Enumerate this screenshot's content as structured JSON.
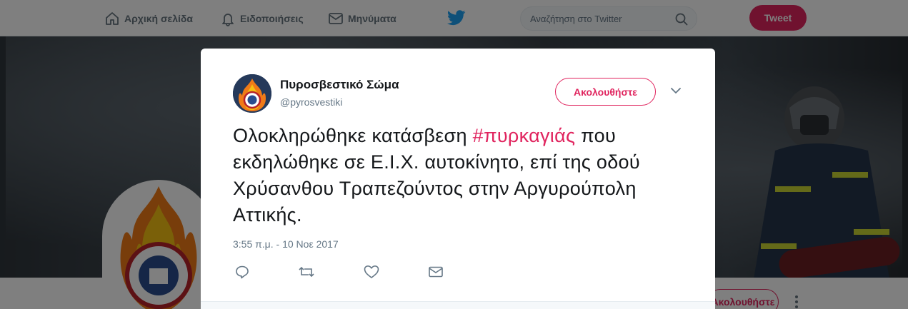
{
  "nav": {
    "home": "Αρχική σελίδα",
    "notifications": "Ειδοποιήσεις",
    "messages": "Μηνύματα",
    "search_placeholder": "Αναζήτηση στο Twitter",
    "tweet_button": "Tweet"
  },
  "profile": {
    "follow_label": "Ακολουθήστε"
  },
  "tweet": {
    "author_name": "Πυροσβεστικό Σώμα",
    "author_handle": "@pyrosvestiki",
    "follow_label": "Ακολουθήστε",
    "text_before": "Ολοκληρώθηκε κατάσβεση ",
    "hashtag": "#πυρκαγιάς",
    "text_after": " που εκδηλώθηκε σε Ε.Ι.Χ. αυτοκίνητο, επί της οδού Χρύσανθου Τραπεζούντος στην Αργυρούπολη Αττικής.",
    "timestamp": "3:55 π.μ. - 10 Νοε 2017"
  },
  "colors": {
    "accent": "#e0245e",
    "text": "#14171a",
    "muted": "#657786",
    "twitter_blue": "#1da1f2"
  },
  "icons": {
    "home": "home-icon",
    "notifications": "bell-icon",
    "messages": "envelope-icon",
    "brand": "twitter-bird-icon",
    "search": "search-icon",
    "reply": "reply-icon",
    "retweet": "retweet-icon",
    "like": "heart-icon",
    "dm": "envelope-icon",
    "caret": "chevron-down-icon"
  }
}
